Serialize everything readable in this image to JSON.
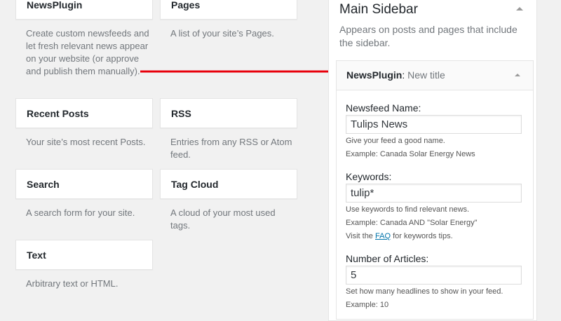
{
  "available_widgets": [
    {
      "title": "NewsPlugin",
      "desc": "Create custom newsfeeds and let fresh relevant news appear on your website (or approve and publish them manually)."
    },
    {
      "title": "Pages",
      "desc": "A list of your site’s Pages."
    },
    {
      "title": "Recent Posts",
      "desc": "Your site’s most recent Posts."
    },
    {
      "title": "RSS",
      "desc": "Entries from any RSS or Atom feed."
    },
    {
      "title": "Search",
      "desc": "A search form for your site."
    },
    {
      "title": "Tag Cloud",
      "desc": "A cloud of your most used tags."
    },
    {
      "title": "Text",
      "desc": "Arbitrary text or HTML."
    }
  ],
  "sidebar": {
    "title": "Main Sidebar",
    "desc": "Appears on posts and pages that include the sidebar."
  },
  "widget": {
    "name": "NewsPlugin",
    "instance_title": "New title",
    "newsfeed_label": "Newsfeed Name:",
    "newsfeed_value": "Tulips News",
    "newsfeed_hint1": "Give your feed a good name.",
    "newsfeed_hint2": "Example: Canada Solar Energy News",
    "keywords_label": "Keywords:",
    "keywords_value": "tulip*",
    "keywords_hint1": "Use keywords to find relevant news.",
    "keywords_hint2": "Example: Canada AND \"Solar Energy\"",
    "keywords_hint3_pre": "Visit the",
    "keywords_hint3_link": "FAQ",
    "keywords_hint3_post": "for keywords tips.",
    "articles_label": "Number of Articles:",
    "articles_value": "5",
    "articles_hint1": "Set how many headlines to show in your feed.",
    "articles_hint2": "Example: 10"
  },
  "colors": {
    "arrow": "#e8000b",
    "link": "#0073aa"
  }
}
